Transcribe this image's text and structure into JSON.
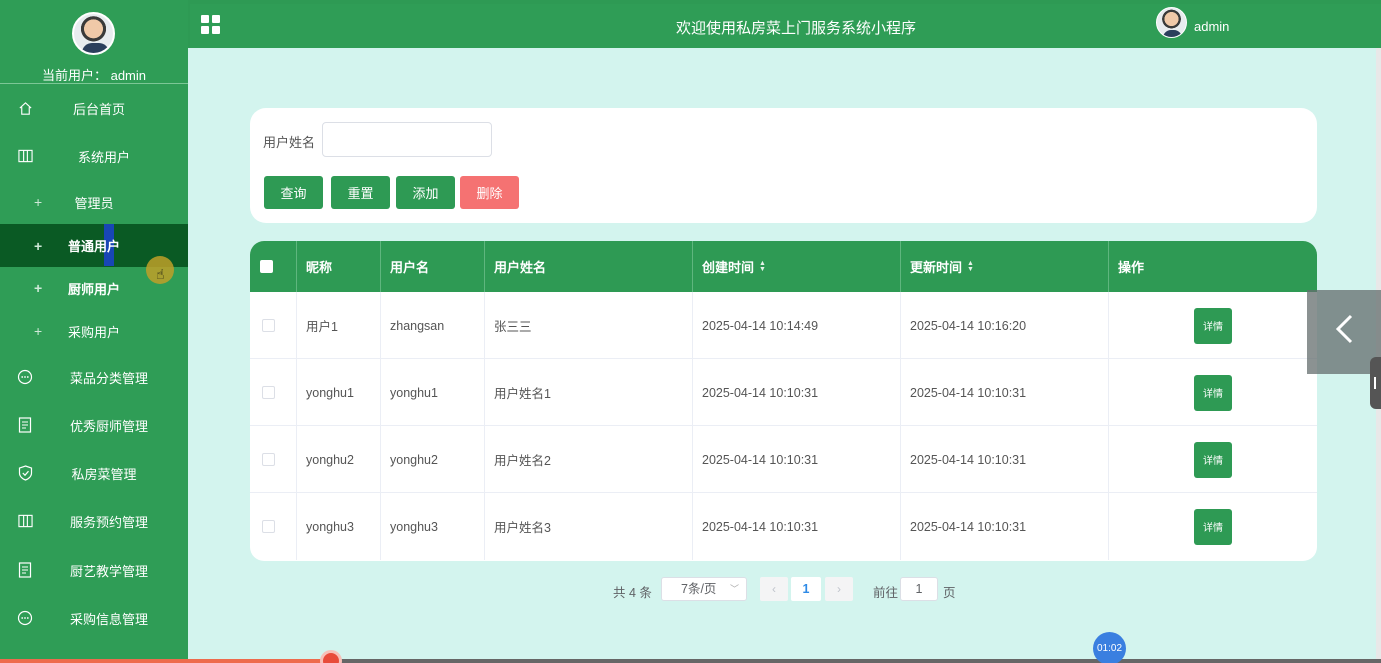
{
  "sidebar": {
    "current_user_label": "当前用户： admin",
    "items": [
      {
        "label": "后台首页",
        "icon": "home-icon"
      },
      {
        "label": "系统用户",
        "icon": "columns-icon"
      },
      {
        "label": "管理员",
        "icon": "plus-icon"
      },
      {
        "label": "普通用户",
        "icon": "plus-icon"
      },
      {
        "label": "厨师用户",
        "icon": "plus-icon"
      },
      {
        "label": "采购用户",
        "icon": "plus-icon"
      },
      {
        "label": "菜品分类管理",
        "icon": "chat-icon"
      },
      {
        "label": "优秀厨师管理",
        "icon": "document-icon"
      },
      {
        "label": "私房菜管理",
        "icon": "shield-icon"
      },
      {
        "label": "服务预约管理",
        "icon": "columns-icon"
      },
      {
        "label": "厨艺教学管理",
        "icon": "document-icon"
      },
      {
        "label": "采购信息管理",
        "icon": "chat-icon"
      }
    ],
    "active_index": 3
  },
  "header": {
    "title": "欢迎使用私房菜上门服务系统小程序",
    "username": "admin"
  },
  "search": {
    "label": "用户姓名",
    "value": "",
    "placeholder": "",
    "buttons": {
      "query": "查询",
      "reset": "重置",
      "add": "添加",
      "delete": "删除"
    }
  },
  "table": {
    "columns": [
      "昵称",
      "用户名",
      "用户姓名",
      "创建时间",
      "更新时间",
      "操作"
    ],
    "rows": [
      {
        "nickname": "用户1",
        "username": "zhangsan",
        "name": "张三三",
        "created": "2025-04-14 10:14:49",
        "updated": "2025-04-14 10:16:20",
        "action": "详情"
      },
      {
        "nickname": "yonghu1",
        "username": "yonghu1",
        "name": "用户姓名1",
        "created": "2025-04-14 10:10:31",
        "updated": "2025-04-14 10:10:31",
        "action": "详情"
      },
      {
        "nickname": "yonghu2",
        "username": "yonghu2",
        "name": "用户姓名2",
        "created": "2025-04-14 10:10:31",
        "updated": "2025-04-14 10:10:31",
        "action": "详情"
      },
      {
        "nickname": "yonghu3",
        "username": "yonghu3",
        "name": "用户姓名3",
        "created": "2025-04-14 10:10:31",
        "updated": "2025-04-14 10:10:31",
        "action": "详情"
      }
    ]
  },
  "pagination": {
    "total": "共 4 条",
    "page_size": "7条/页",
    "current_page": "1",
    "goto_label": "前往",
    "goto_value": "1",
    "page_suffix": "页"
  },
  "player": {
    "time": "01:02",
    "progress": 0.24
  },
  "colors": {
    "primary": "#2e9a54",
    "active_nav": "#0a5a24",
    "danger": "#f57272",
    "main_bg": "#d3f4ee"
  }
}
